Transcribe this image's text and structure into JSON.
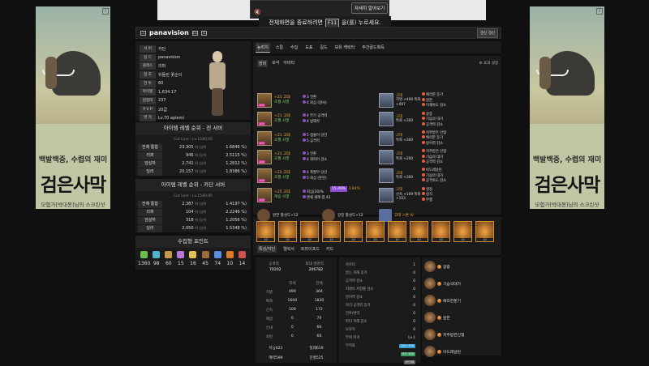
{
  "ads": {
    "slogan": "백발백중, 수렵의 재미",
    "logo": "검은사막",
    "caption": "모험가[박대봉]님의 스크린샷"
  },
  "video": {
    "more_label": "자세히 알아보기",
    "notice_pre": "전체화면을 종료하려면",
    "notice_key": "F11",
    "notice_post": "을(를) 누르세요."
  },
  "header": {
    "name": "panavision",
    "badge_lv": "Lv",
    "update_btn": "갱신 갱신"
  },
  "profile": {
    "rows": [
      {
        "k": "서 버",
        "v": "카단"
      },
      {
        "k": "길 드",
        "v": "panavision"
      },
      {
        "k": "클래스",
        "v": "리퍼"
      },
      {
        "k": "칭 호",
        "v": "뒤돌린 꽃손이"
      },
      {
        "k": "전 투",
        "v": "60"
      },
      {
        "k": "아이템",
        "v": "1,634.17"
      },
      {
        "k": "원정대",
        "v": "237"
      },
      {
        "k": "P V P",
        "v": "20급"
      },
      {
        "k": "영 지",
        "v": "Lv.70 apiemi"
      }
    ]
  },
  "rank_all": {
    "title": "아이템 레벨 순위 - 전 서버",
    "cutline": "Cut Line : Lv.1540.00",
    "rows": [
      {
        "l": "전체 통합",
        "a": "23,305",
        "b": "1.6846 %"
      },
      {
        "l": "리퍼",
        "a": "946",
        "b": "2.5115 %"
      },
      {
        "l": "암살자",
        "a": "2,741",
        "b": "1.2812 %"
      },
      {
        "l": "딜러",
        "a": "20,157",
        "b": "1.8386 %"
      }
    ]
  },
  "rank_server": {
    "title": "아이템 레벨 순위 - 카단 서버",
    "cutline": "Cut Line : Lv.1540.00",
    "rows": [
      {
        "l": "전체 통합",
        "a": "2,387",
        "b": "1.4197 %"
      },
      {
        "l": "리퍼",
        "a": "104",
        "b": "2.2246 %"
      },
      {
        "l": "암살자",
        "a": "318",
        "b": "1.2056 %"
      },
      {
        "l": "딜러",
        "a": "2,050",
        "b": "1.5348 %"
      }
    ],
    "rank_suffix": "위 (상위"
  },
  "collect": {
    "title": "수집형 포인트",
    "items": [
      "1360",
      "98",
      "60",
      "15",
      "16",
      "45",
      "74",
      "10",
      "14"
    ]
  },
  "tabs": [
    "능력치",
    "스킬",
    "수집",
    "도표",
    "길드",
    "보유 캐릭터",
    "주간골드획득"
  ],
  "equip": {
    "tabs": [
      "장비",
      "보석",
      "아바타"
    ],
    "effect": "효과 설정",
    "gear": [
      {
        "enh": "+21 고대",
        "name": "초월 사멸",
        "o1": "3 전환",
        "o2": "4 회심 (정씨)"
      },
      {
        "enh": "+21 고대",
        "name": "초월 사멸",
        "o1": "4 부기 공격력",
        "o2": "4 방해작"
      },
      {
        "enh": "+21 고대",
        "name": "초월 사멸",
        "o1": "5 정불이 당인",
        "o2": "5 공격력"
      },
      {
        "enh": "+21 고대",
        "name": "초월 사멸",
        "o1": "3 전환",
        "o2": "4 회피어 감소"
      },
      {
        "enh": "+22 고대",
        "name": "초월 사멸",
        "o1": "4 폭발부 당인",
        "o2": "5 회심 (훈련)"
      },
      {
        "enh": "+25 고대",
        "name": "계승 사멸",
        "o1": "회심(20)%",
        "o2": "엔쉐 세례 합 43"
      }
    ],
    "elixir_pct": "15.49%",
    "elixir_pct2": "3.84%",
    "acc": [
      {
        "t": "고대",
        "s": "치명 +499 특화 +497",
        "o1": "예리한 둔기",
        "o2": "원한",
        "o3": "이재속도 감소"
      },
      {
        "t": "고대",
        "s": "특화 +300",
        "o1": "갈증",
        "o2": "기습의 대가",
        "o3": "공격력 감소"
      },
      {
        "t": "고대",
        "s": "특화 +300",
        "o1": "저주받은 인형",
        "o2": "예리한 둔기",
        "o3": "방어력 감소"
      },
      {
        "t": "고대",
        "s": "특화 +200",
        "o1": "저주받은 인형",
        "o2": "기습의 대가",
        "o3": "공격력 감소"
      },
      {
        "t": "고대",
        "s": "특화 +300",
        "o1": "아드레날린",
        "o2": "기습의 대가",
        "o3": "공격속도 감소"
      },
      {
        "t": "고대",
        "s": "신속 +109 특화 +103",
        "o1": "냉정",
        "o2": "정직",
        "o3": "무행"
      }
    ],
    "misc1": "원한 활성도+12",
    "misc2": "갈증 활성도+12",
    "stone": "고대 스톤 IV",
    "stone_opts": [
      "기습의대가",
      "아드레날린",
      "공격속도 감소"
    ]
  },
  "gems": [
    "10",
    "10",
    "10",
    "10",
    "10",
    "10",
    "10",
    "10",
    "10",
    "10",
    "10"
  ],
  "bottom_tabs": [
    "특성/각인",
    "엘릭서",
    "트라이포드",
    "카드"
  ],
  "stats": {
    "atk_label": "공격력",
    "atk": "70202",
    "hp_label": "최대 생명력",
    "hp": "206782",
    "col1": "악세",
    "col2": "전체",
    "rows": [
      {
        "k": "치명",
        "a": "499",
        "b": "364"
      },
      {
        "k": "특화",
        "a": "1600",
        "b": "1830"
      },
      {
        "k": "신속",
        "a": "109",
        "b": "172"
      },
      {
        "k": "제압",
        "a": "0",
        "b": "70"
      },
      {
        "k": "인내",
        "a": "0",
        "b": "66"
      },
      {
        "k": "숙련",
        "a": "0",
        "b": "66"
      }
    ],
    "f1": "지능621",
    "f2": "딜레619",
    "f3": "매력599",
    "f4": "친절525"
  },
  "engravings": [
    {
      "k": "카르티",
      "v": "1"
    },
    {
      "k": "받는 피해 증가",
      "v": "0"
    },
    {
      "k": "공격력 감소",
      "v": "0"
    },
    {
      "k": "치명타 저항률 감소",
      "v": "0"
    },
    {
      "k": "방어력 감소",
      "v": "0"
    },
    {
      "k": "마리 공격력 증가",
      "v": "0"
    },
    {
      "k": "전투/변역",
      "v": "0"
    },
    {
      "k": "파티 피해 감소",
      "v": "0"
    },
    {
      "k": "보호막",
      "v": "0"
    },
    {
      "k": "부위 파괴",
      "v": "Lv.1"
    },
    {
      "k": "무력화",
      "v": "101~100"
    },
    {
      "k": "",
      "v": "51~100"
    },
    {
      "k": "",
      "v": "0~50"
    }
  ],
  "cards": [
    {
      "lv": "3",
      "name": "갈증"
    },
    {
      "lv": "3",
      "name": "기습의대가"
    },
    {
      "lv": "3",
      "name": "예리한둔기"
    },
    {
      "lv": "3",
      "name": "원한"
    },
    {
      "lv": "3",
      "name": "저주받은인형"
    },
    {
      "lv": "1",
      "name": "아드레날린"
    }
  ]
}
